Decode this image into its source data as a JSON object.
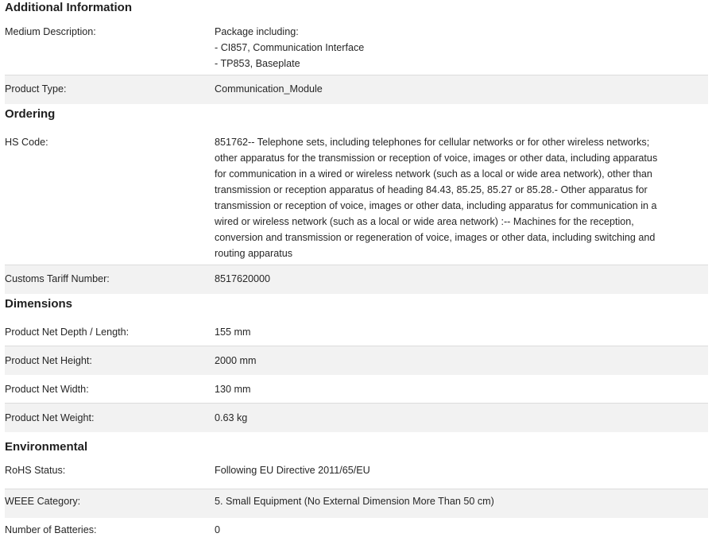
{
  "sections": [
    {
      "title": "Additional Information",
      "rows": [
        {
          "label": "Medium Description:",
          "value_lines": [
            "Package including:",
            "- CI857, Communication Interface",
            "- TP853, Baseplate"
          ]
        },
        {
          "label": "Product Type:",
          "value": "Communication_Module"
        }
      ]
    },
    {
      "title": "Ordering",
      "rows": [
        {
          "label": "HS Code:",
          "value_lines": [
            "851762-- Telephone sets, including telephones for cellular networks or for other wireless networks;",
            "other apparatus for the transmission or reception of voice, images or other data, including apparatus",
            "for communication in a wired or wireless network (such as a local or wide area network), other than",
            "transmission or reception apparatus of heading 84.43, 85.25, 85.27 or 85.28.- Other apparatus for",
            "transmission or reception of voice, images or other data, including apparatus for communication in a",
            "wired or wireless network (such as a local or wide area network) :-- Machines for the reception,",
            "conversion and transmission or regeneration of voice, images or other data, including switching and",
            "routing apparatus"
          ]
        },
        {
          "label": "Customs Tariff Number:",
          "value": "8517620000"
        }
      ]
    },
    {
      "title": "Dimensions",
      "rows": [
        {
          "label": "Product Net Depth / Length:",
          "value": "155 mm"
        },
        {
          "label": "Product Net Height:",
          "value": "2000 mm"
        },
        {
          "label": "Product Net Width:",
          "value": "130 mm"
        },
        {
          "label": "Product Net Weight:",
          "value": "0.63 kg"
        }
      ]
    },
    {
      "title": "Environmental",
      "rows": [
        {
          "label": "RoHS Status:",
          "value": "Following EU Directive 2011/65/EU"
        },
        {
          "label": "WEEE Category:",
          "value": "5. Small Equipment (No External Dimension More Than 50 cm)"
        },
        {
          "label": "Number of Batteries:",
          "value": "0"
        }
      ]
    }
  ]
}
